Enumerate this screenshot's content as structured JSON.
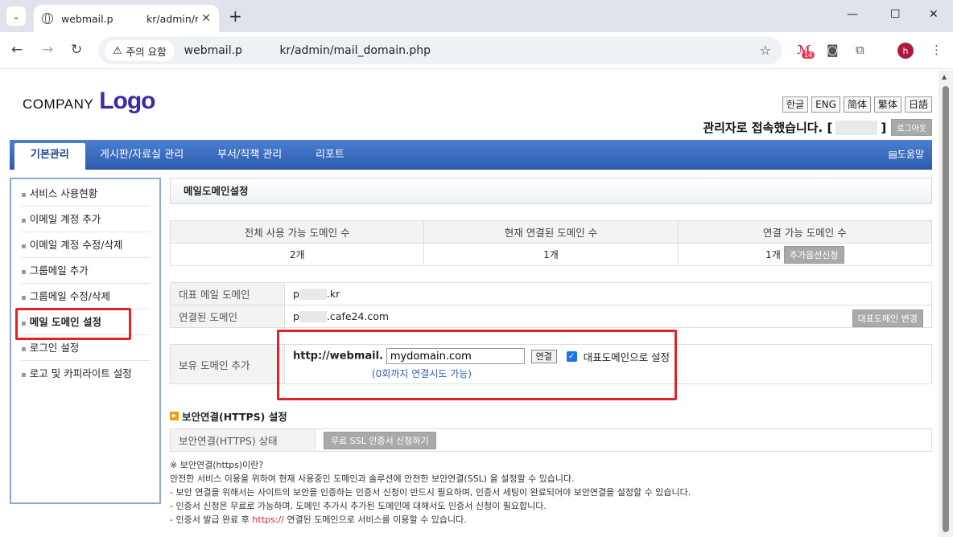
{
  "browser": {
    "tab_title": "webmail.p    kr/admin/ma",
    "security_label": "주의 요함",
    "url": "webmail.p    kr/admin/mail_domain.php",
    "ext_badge": "14",
    "avatar_letter": "h"
  },
  "header": {
    "company": "COMPANY",
    "logo": "Logo",
    "languages": [
      "한글",
      "ENG",
      "简体",
      "繁体",
      "日語"
    ],
    "login_message": "관리자로 접속했습니다. [",
    "login_close": "]",
    "logout": "로그아웃"
  },
  "nav": {
    "items": [
      "기본관리",
      "게시판/자료실 관리",
      "부서/직책 관리",
      "리포트"
    ],
    "help": "도움말"
  },
  "sidebar": {
    "items": [
      "서비스 사용현황",
      "이메일 계정 추가",
      "이메일 계정 수정/삭제",
      "그룹메일 추가",
      "그룹메일 수정/삭제",
      "메일 도메인 설정",
      "로그인 설정",
      "로고 및 카피라이트 설정"
    ]
  },
  "main": {
    "title": "메일도메인설정",
    "stats": {
      "headers": [
        "전체 사용 가능 도메인 수",
        "현재 연결된 도메인 수",
        "연결 가능 도메인 수"
      ],
      "values": [
        "2개",
        "1개",
        "1개"
      ],
      "add_option": "추가옵션신청"
    },
    "info": {
      "rep_label": "대표 메일 도메인",
      "rep_prefix": "p",
      "rep_suffix": ".kr",
      "linked_label": "연결된 도메인",
      "linked_prefix": "p",
      "linked_suffix": ".cafe24.com",
      "change_rep": "대표도메인 변경"
    },
    "add_domain": {
      "label": "보유 도메인 추가",
      "prefix": "http://webmail.",
      "input_value": "mydomain.com",
      "connect": "연결",
      "checkbox_label": "대표도메인으로 설정",
      "retry_note": "(0회까지 연결시도 가능)"
    },
    "https": {
      "title": "보안연결(HTTPS) 설정",
      "status_label": "보안연결(HTTPS) 상태",
      "ssl_button": "무료 SSL 인증서 신청하기",
      "notes_head": "※ 보안연결(https)이란?",
      "notes": [
        "안전한 서비스 이용을 위하여 현재 사용중인 도메인과 솔루션에 안전한 보안연결(SSL) 을 설정할 수 있습니다.",
        "- 보안 연결을 위해서는 사이트의 보안을 인증하는 인증서 신청이 반드시 필요하며, 인증서 세팅이 완료되어야 보안연결을 설정할 수 있습니다.",
        "- 인증서 신청은 무료로 가능하며, 도메인 추가시 추가된 도메인에 대해서도 인증서 신청이 필요합니다."
      ],
      "last_note_pre": "- 인증서 발급 완료 후 ",
      "last_note_red": "https://",
      "last_note_post": " 연결된 도메인으로 서비스를 이용할 수 있습니다."
    }
  }
}
